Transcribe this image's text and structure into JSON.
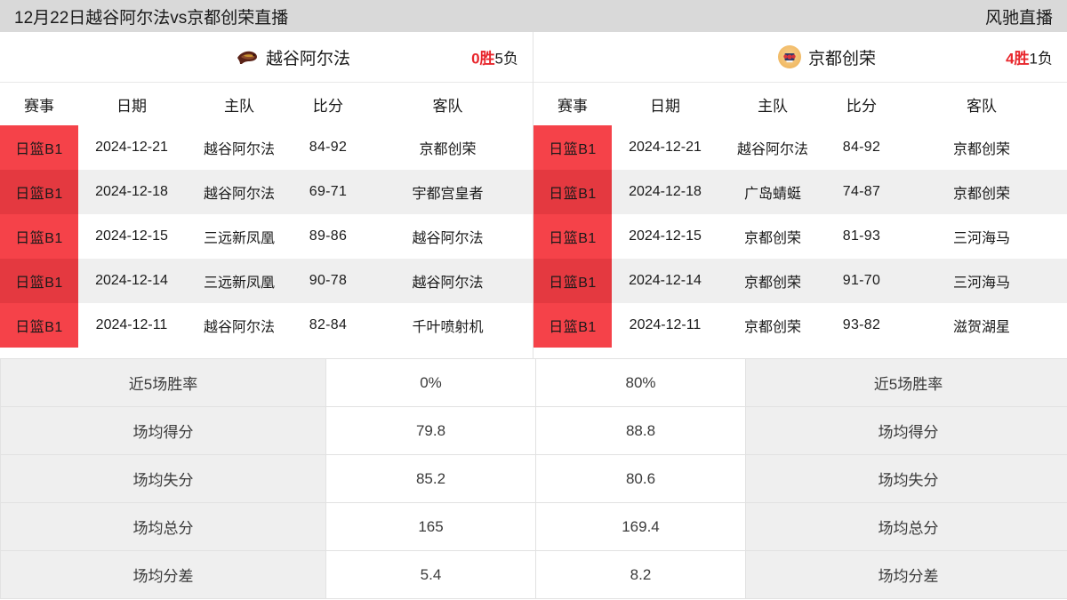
{
  "topbar": {
    "title": "12月22日越谷阿尔法vs京都创荣直播",
    "brand": "风驰直播"
  },
  "colors": {
    "accent_red": "#f54249",
    "accent_red_dark": "#e43940",
    "record_win": "#e8262c",
    "topbar_bg": "#d9d9d9",
    "stripe_bg": "#efefef"
  },
  "panels": [
    {
      "side": "left",
      "team": {
        "name": "越谷阿尔法",
        "logo": "koshigaya-alphas-logo",
        "record_win": "0胜",
        "record_loss": "5负"
      },
      "columns": [
        "赛事",
        "日期",
        "主队",
        "比分",
        "客队"
      ],
      "rows": [
        {
          "league": "日篮B1",
          "date": "2024-12-21",
          "home": "越谷阿尔法",
          "score": "84-92",
          "away": "京都创荣"
        },
        {
          "league": "日篮B1",
          "date": "2024-12-18",
          "home": "越谷阿尔法",
          "score": "69-71",
          "away": "宇都宫皇者"
        },
        {
          "league": "日篮B1",
          "date": "2024-12-15",
          "home": "三远新凤凰",
          "score": "89-86",
          "away": "越谷阿尔法"
        },
        {
          "league": "日篮B1",
          "date": "2024-12-14",
          "home": "三远新凤凰",
          "score": "90-78",
          "away": "越谷阿尔法"
        },
        {
          "league": "日篮B1",
          "date": "2024-12-11",
          "home": "越谷阿尔法",
          "score": "82-84",
          "away": "千叶喷射机"
        }
      ]
    },
    {
      "side": "right",
      "team": {
        "name": "京都创荣",
        "logo": "kyoto-hannaryz-logo",
        "record_win": "4胜",
        "record_loss": "1负"
      },
      "columns": [
        "赛事",
        "日期",
        "主队",
        "比分",
        "客队"
      ],
      "rows": [
        {
          "league": "日篮B1",
          "date": "2024-12-21",
          "home": "越谷阿尔法",
          "score": "84-92",
          "away": "京都创荣"
        },
        {
          "league": "日篮B1",
          "date": "2024-12-18",
          "home": "广岛蜻蜓",
          "score": "74-87",
          "away": "京都创荣"
        },
        {
          "league": "日篮B1",
          "date": "2024-12-15",
          "home": "京都创荣",
          "score": "81-93",
          "away": "三河海马"
        },
        {
          "league": "日篮B1",
          "date": "2024-12-14",
          "home": "京都创荣",
          "score": "91-70",
          "away": "三河海马"
        },
        {
          "league": "日篮B1",
          "date": "2024-12-11",
          "home": "京都创荣",
          "score": "93-82",
          "away": "滋贺湖星"
        }
      ]
    }
  ],
  "stats": [
    {
      "label_left": "近5场胜率",
      "value_left": "0%",
      "value_right": "80%",
      "label_right": "近5场胜率"
    },
    {
      "label_left": "场均得分",
      "value_left": "79.8",
      "value_right": "88.8",
      "label_right": "场均得分"
    },
    {
      "label_left": "场均失分",
      "value_left": "85.2",
      "value_right": "80.6",
      "label_right": "场均失分"
    },
    {
      "label_left": "场均总分",
      "value_left": "165",
      "value_right": "169.4",
      "label_right": "场均总分"
    },
    {
      "label_left": "场均分差",
      "value_left": "5.4",
      "value_right": "8.2",
      "label_right": "场均分差"
    }
  ]
}
